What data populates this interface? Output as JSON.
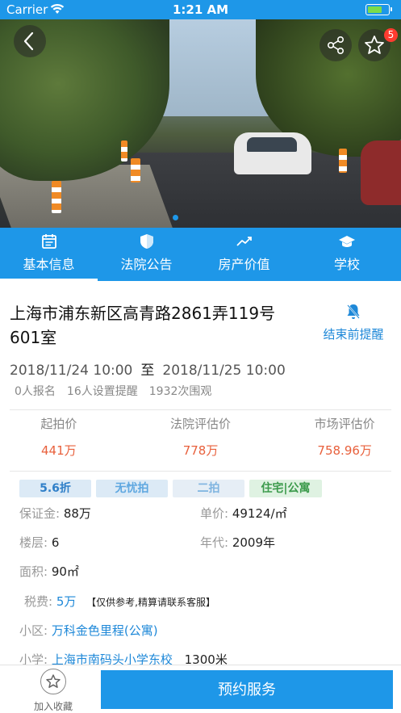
{
  "status_bar": {
    "carrier": "Carrier",
    "time": "1:21 AM",
    "battery_level": 0.7,
    "icons": [
      "wifi-icon",
      "battery-icon"
    ]
  },
  "hero": {
    "badge_count": "5",
    "slide_total": 1,
    "slide_index": 1,
    "icons": [
      "back-icon",
      "share-icon",
      "star-icon"
    ]
  },
  "tabs": [
    {
      "label": "基本信息",
      "icon": "calendar-icon",
      "active": true
    },
    {
      "label": "法院公告",
      "icon": "shield-icon",
      "active": false
    },
    {
      "label": "房产价值",
      "icon": "trend-icon",
      "active": false
    },
    {
      "label": "学校",
      "icon": "graduation-cap-icon",
      "active": false
    }
  ],
  "property": {
    "title": "上海市浦东新区高青路2861弄119号601室",
    "remind_label": "结束前提醒",
    "start": "2018/11/24 10:00",
    "to": "至",
    "end": "2018/11/25 10:00",
    "stats": [
      "0人报名",
      "16人设置提醒",
      "1932次围观"
    ]
  },
  "prices": [
    {
      "label": "起拍价",
      "value": "441万"
    },
    {
      "label": "法院评估价",
      "value": "778万"
    },
    {
      "label": "市场评估价",
      "value": "758.96万"
    }
  ],
  "tags": [
    "5.6折",
    "无忧拍",
    "二拍",
    "住宅|公寓"
  ],
  "details": {
    "deposit_label": "保证金:",
    "deposit": "88万",
    "unit_price_label": "单价:",
    "unit_price": "49124/㎡",
    "floor_label": "楼层:",
    "floor": "6",
    "year_label": "年代:",
    "year": "2009年",
    "area_label": "面积:",
    "area": "90㎡",
    "tax_label": "税费:",
    "tax": "5万",
    "tax_note": "【仅供参考,精算请联系客服】",
    "community_label": "小区:",
    "community": "万科金色里程(公寓)",
    "school_label": "小学:",
    "school": "上海市南码头小学东校",
    "school_distance": "1300米"
  },
  "bottom": {
    "collect_label": "加入收藏",
    "reserve_label": "预约服务"
  },
  "colors": {
    "primary": "#1e97e8",
    "price": "#e8603c",
    "link": "#1e88d8",
    "badge": "#ff3b30"
  }
}
